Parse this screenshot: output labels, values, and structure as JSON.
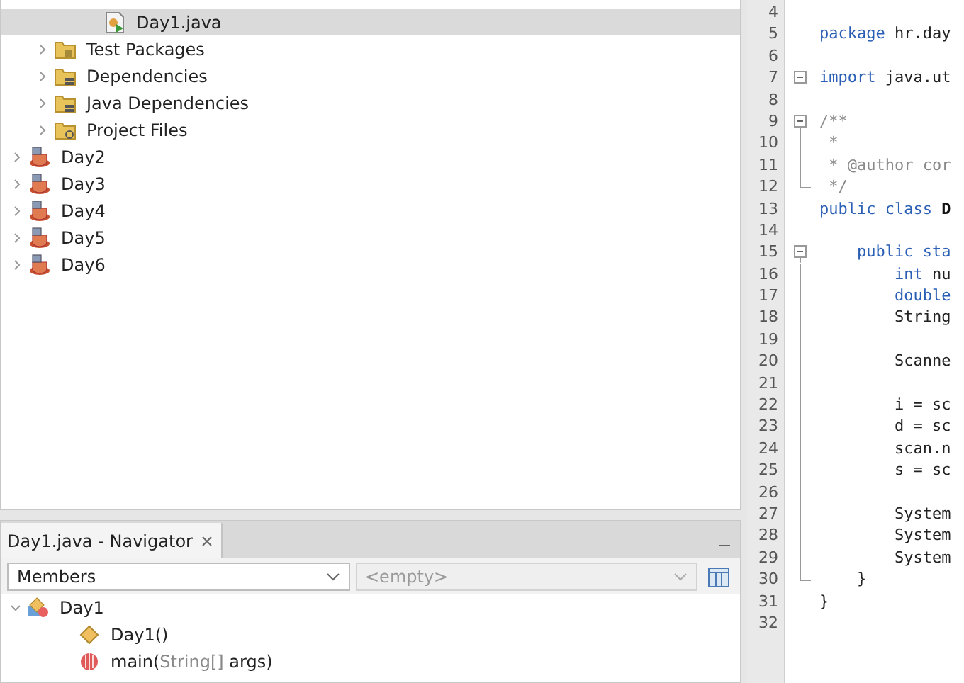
{
  "projects_tree": {
    "open_files": [
      {
        "label": "Day1.java",
        "selected": true
      }
    ],
    "folders": [
      {
        "label": "Test Packages",
        "kind": "tests"
      },
      {
        "label": "Dependencies",
        "kind": "libs"
      },
      {
        "label": "Java Dependencies",
        "kind": "libs"
      },
      {
        "label": "Project Files",
        "kind": "config"
      }
    ],
    "projects": [
      {
        "label": "Day2",
        "expanded": false
      },
      {
        "label": "Day3",
        "expanded": false
      },
      {
        "label": "Day4",
        "expanded": false
      },
      {
        "label": "Day5",
        "expanded": false
      },
      {
        "label": "Day6",
        "expanded": false
      }
    ]
  },
  "navigator": {
    "tab": {
      "label": "Day1.java - Navigator",
      "selected": true
    },
    "filter": {
      "value": "Members"
    },
    "scope": {
      "value": "<empty>",
      "disabled": true
    },
    "tree": [
      {
        "label": "Day1",
        "kind": "class",
        "expanded": true,
        "children": [
          {
            "parts": [
              {
                "text": "Day1()",
                "muted": false
              }
            ],
            "kind": "constructor"
          },
          {
            "parts": [
              {
                "text": "main(",
                "muted": false
              },
              {
                "text": "String[]",
                "muted": true
              },
              {
                "text": " args)",
                "muted": false
              }
            ],
            "kind": "method"
          }
        ]
      }
    ]
  },
  "editor": {
    "lines": [
      {
        "number": "4",
        "kind": "plain"
      },
      {
        "number": "5",
        "kind": "plain",
        "segments": [
          {
            "text": "package",
            "kind": "keyword"
          },
          {
            "text": " hr.day",
            "kind": "plain"
          }
        ]
      },
      {
        "number": "6",
        "kind": "plain"
      },
      {
        "number": "7",
        "kind": "fold_single",
        "segments": [
          {
            "text": "import",
            "kind": "keyword"
          },
          {
            "text": " java.ut",
            "kind": "plain"
          }
        ]
      },
      {
        "number": "8",
        "kind": "plain"
      },
      {
        "number": "9",
        "kind": "fold_start",
        "segments": [
          {
            "text": "/**",
            "kind": "comment"
          }
        ]
      },
      {
        "number": "10",
        "kind": "fold_bar",
        "segments": [
          {
            "text": " *",
            "kind": "comment"
          }
        ]
      },
      {
        "number": "11",
        "kind": "fold_bar",
        "segments": [
          {
            "text": " * @author cor",
            "kind": "comment"
          }
        ]
      },
      {
        "number": "12",
        "kind": "fold_end",
        "segments": [
          {
            "text": " */",
            "kind": "comment"
          }
        ]
      },
      {
        "number": "13",
        "kind": "plain",
        "segments": [
          {
            "text": "public class ",
            "kind": "keyword"
          },
          {
            "text": "D",
            "kind": "bold"
          }
        ]
      },
      {
        "number": "14",
        "kind": "plain"
      },
      {
        "number": "15",
        "kind": "fold_start",
        "segments": [
          {
            "text": "    public sta",
            "kind": "keyword"
          }
        ]
      },
      {
        "number": "16",
        "kind": "fold_bar",
        "segments": [
          {
            "text": "        int",
            "kind": "keyword"
          },
          {
            "text": " nu",
            "kind": "plain"
          }
        ]
      },
      {
        "number": "17",
        "kind": "fold_bar",
        "segments": [
          {
            "text": "        double",
            "kind": "keyword"
          }
        ]
      },
      {
        "number": "18",
        "kind": "fold_bar",
        "segments": [
          {
            "text": "        String",
            "kind": "plain"
          }
        ]
      },
      {
        "number": "19",
        "kind": "fold_bar"
      },
      {
        "number": "20",
        "kind": "fold_bar",
        "segments": [
          {
            "text": "        Scanne",
            "kind": "plain"
          }
        ]
      },
      {
        "number": "21",
        "kind": "fold_bar"
      },
      {
        "number": "22",
        "kind": "fold_bar",
        "segments": [
          {
            "text": "        i = sc",
            "kind": "plain"
          }
        ]
      },
      {
        "number": "23",
        "kind": "fold_bar",
        "segments": [
          {
            "text": "        d = sc",
            "kind": "plain"
          }
        ]
      },
      {
        "number": "24",
        "kind": "fold_bar",
        "segments": [
          {
            "text": "        scan.n",
            "kind": "plain"
          }
        ]
      },
      {
        "number": "25",
        "kind": "fold_bar",
        "segments": [
          {
            "text": "        s = sc",
            "kind": "plain"
          }
        ]
      },
      {
        "number": "26",
        "kind": "fold_bar"
      },
      {
        "number": "27",
        "kind": "fold_bar",
        "segments": [
          {
            "text": "        System",
            "kind": "plain"
          }
        ]
      },
      {
        "number": "28",
        "kind": "fold_bar",
        "segments": [
          {
            "text": "        System",
            "kind": "plain"
          }
        ]
      },
      {
        "number": "29",
        "kind": "fold_bar",
        "segments": [
          {
            "text": "        System",
            "kind": "plain"
          }
        ]
      },
      {
        "number": "30",
        "kind": "fold_end",
        "segments": [
          {
            "text": "    }",
            "kind": "plain"
          }
        ]
      },
      {
        "number": "31",
        "kind": "plain",
        "segments": [
          {
            "text": "}",
            "kind": "plain"
          }
        ]
      },
      {
        "number": "32",
        "kind": "plain"
      }
    ]
  }
}
